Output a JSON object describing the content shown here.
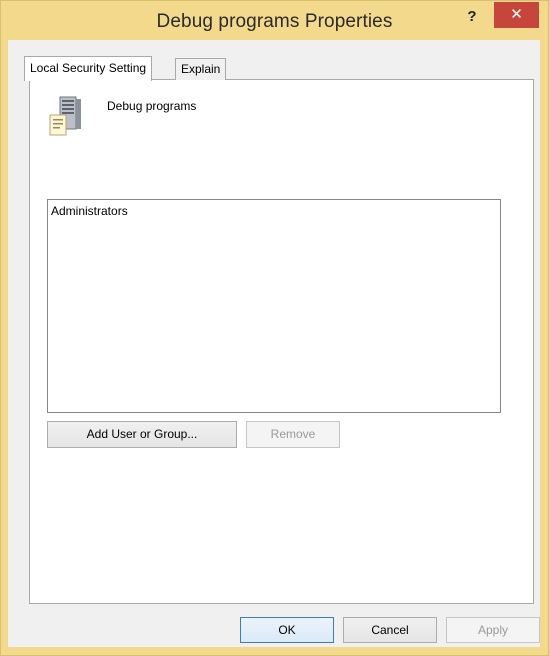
{
  "window": {
    "title": "Debug programs Properties",
    "help_glyph": "?",
    "close_glyph": "✕",
    "frame_color": "#f2d98c",
    "close_color": "#c7463c"
  },
  "tabs": [
    {
      "label": "Local Security Setting",
      "active": true
    },
    {
      "label": "Explain",
      "active": false
    }
  ],
  "policy": {
    "icon": "server-policy-icon",
    "name": "Debug programs"
  },
  "principals": {
    "items": [
      "Administrators"
    ]
  },
  "buttons": {
    "add": "Add User or Group...",
    "remove": "Remove",
    "ok": "OK",
    "cancel": "Cancel",
    "apply": "Apply"
  }
}
